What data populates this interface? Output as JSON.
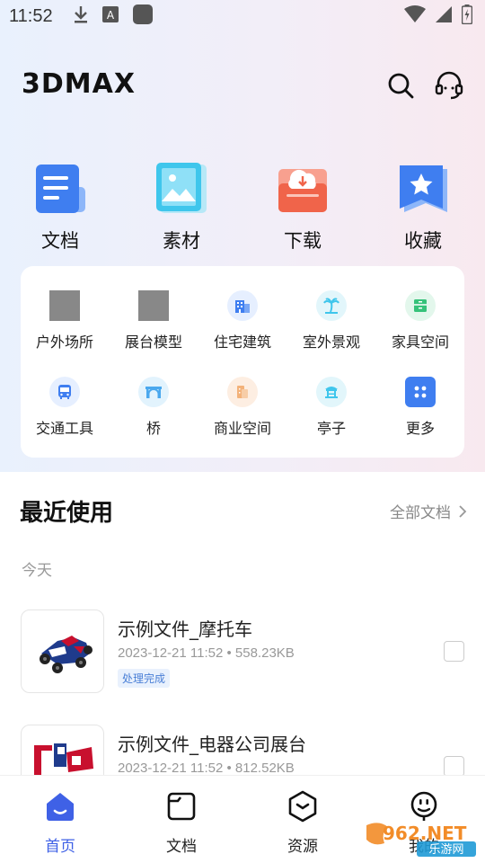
{
  "status_bar": {
    "time": "11:52"
  },
  "header": {
    "logo": "3DMAX"
  },
  "top_categories": [
    {
      "label": "文档",
      "icon": "document-icon"
    },
    {
      "label": "素材",
      "icon": "image-icon"
    },
    {
      "label": "下载",
      "icon": "download-icon"
    },
    {
      "label": "收藏",
      "icon": "star-bookmark-icon"
    }
  ],
  "sub_categories": [
    {
      "label": "户外场所",
      "icon": "placeholder-image"
    },
    {
      "label": "展台模型",
      "icon": "placeholder-image"
    },
    {
      "label": "住宅建筑",
      "icon": "building-icon"
    },
    {
      "label": "室外景观",
      "icon": "palm-tree-icon"
    },
    {
      "label": "家具空间",
      "icon": "cabinet-icon"
    },
    {
      "label": "交通工具",
      "icon": "bus-icon"
    },
    {
      "label": "桥",
      "icon": "bridge-icon"
    },
    {
      "label": "商业空间",
      "icon": "shop-icon"
    },
    {
      "label": "亭子",
      "icon": "pavilion-icon"
    },
    {
      "label": "更多",
      "icon": "more-grid-icon"
    }
  ],
  "recent": {
    "title": "最近使用",
    "all_docs": "全部文档",
    "group_label": "今天",
    "files": [
      {
        "name": "示例文件_摩托车",
        "meta": "2023-12-21 11:52 • 558.23KB",
        "badge": "处理完成"
      },
      {
        "name": "示例文件_电器公司展台",
        "meta": "2023-12-21 11:52 • 812.52KB",
        "badge": ""
      }
    ]
  },
  "tabs": [
    {
      "label": "首页",
      "active": true
    },
    {
      "label": "文档",
      "active": false
    },
    {
      "label": "资源",
      "active": false
    },
    {
      "label": "我的",
      "active": false
    }
  ],
  "watermark": {
    "text": "962.NET",
    "sub": "乐游网"
  },
  "colors": {
    "accent": "#3f61e6",
    "badge_text": "#4a7fd6",
    "badge_bg": "#e9f1fd"
  }
}
